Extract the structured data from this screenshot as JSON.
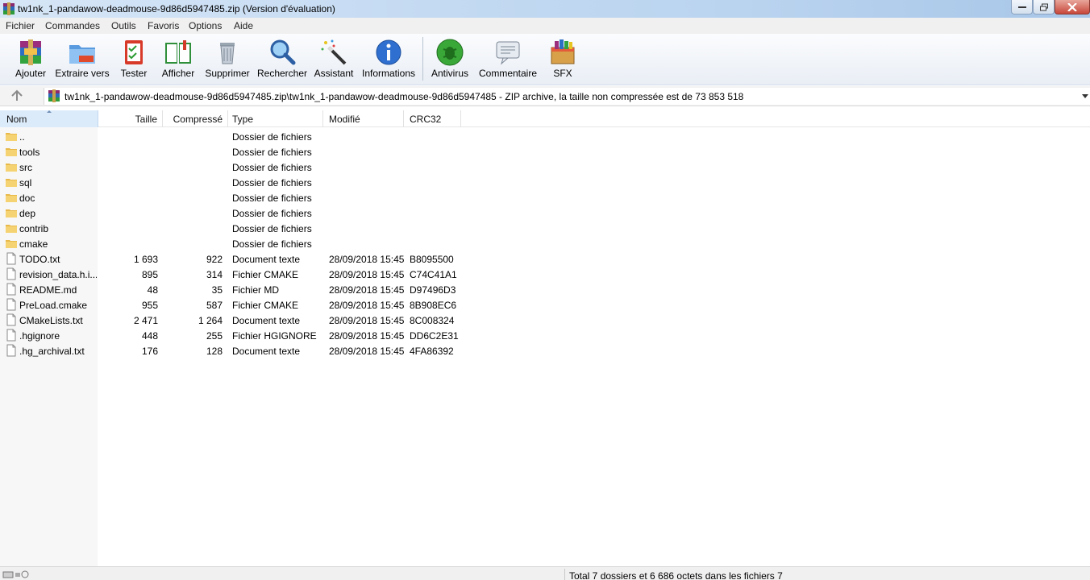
{
  "window": {
    "title": "tw1nk_1-pandawow-deadmouse-9d86d5947485.zip (Version d'évaluation)"
  },
  "menu": [
    "Fichier",
    "Commandes",
    "Outils",
    "Favoris",
    "Options",
    "Aide"
  ],
  "toolbar": {
    "buttons": [
      {
        "label": "Ajouter",
        "icon": "add-archive-icon"
      },
      {
        "label": "Extraire vers",
        "icon": "extract-folder-icon"
      },
      {
        "label": "Tester",
        "icon": "test-checklist-icon"
      },
      {
        "label": "Afficher",
        "icon": "view-book-icon"
      },
      {
        "label": "Supprimer",
        "icon": "trash-icon"
      },
      {
        "label": "Rechercher",
        "icon": "magnifier-icon"
      },
      {
        "label": "Assistant",
        "icon": "wizard-wand-icon"
      },
      {
        "label": "Informations",
        "icon": "info-icon"
      },
      {
        "label": "Antivirus",
        "icon": "antivirus-bug-icon"
      },
      {
        "label": "Commentaire",
        "icon": "comment-icon"
      },
      {
        "label": "SFX",
        "icon": "sfx-box-icon"
      }
    ]
  },
  "address": {
    "path": "tw1nk_1-pandawow-deadmouse-9d86d5947485.zip\\tw1nk_1-pandawow-deadmouse-9d86d5947485 - ZIP archive, la taille non compressée est de 73 853 518"
  },
  "columns": {
    "name": "Nom",
    "size": "Taille",
    "compressed": "Compressé",
    "type": "Type",
    "modified": "Modifié",
    "crc": "CRC32"
  },
  "files": [
    {
      "name": "..",
      "kind": "folder",
      "size": "",
      "compressed": "",
      "type": "Dossier de fichiers",
      "modified": "",
      "crc": ""
    },
    {
      "name": "tools",
      "kind": "folder",
      "size": "",
      "compressed": "",
      "type": "Dossier de fichiers",
      "modified": "",
      "crc": ""
    },
    {
      "name": "src",
      "kind": "folder",
      "size": "",
      "compressed": "",
      "type": "Dossier de fichiers",
      "modified": "",
      "crc": ""
    },
    {
      "name": "sql",
      "kind": "folder",
      "size": "",
      "compressed": "",
      "type": "Dossier de fichiers",
      "modified": "",
      "crc": ""
    },
    {
      "name": "doc",
      "kind": "folder",
      "size": "",
      "compressed": "",
      "type": "Dossier de fichiers",
      "modified": "",
      "crc": ""
    },
    {
      "name": "dep",
      "kind": "folder",
      "size": "",
      "compressed": "",
      "type": "Dossier de fichiers",
      "modified": "",
      "crc": ""
    },
    {
      "name": "contrib",
      "kind": "folder",
      "size": "",
      "compressed": "",
      "type": "Dossier de fichiers",
      "modified": "",
      "crc": ""
    },
    {
      "name": "cmake",
      "kind": "folder",
      "size": "",
      "compressed": "",
      "type": "Dossier de fichiers",
      "modified": "",
      "crc": ""
    },
    {
      "name": "TODO.txt",
      "kind": "file",
      "size": "1 693",
      "compressed": "922",
      "type": "Document texte",
      "modified": "28/09/2018 15:45",
      "crc": "B8095500"
    },
    {
      "name": "revision_data.h.i...",
      "kind": "file",
      "size": "895",
      "compressed": "314",
      "type": "Fichier CMAKE",
      "modified": "28/09/2018 15:45",
      "crc": "C74C41A1"
    },
    {
      "name": "README.md",
      "kind": "file",
      "size": "48",
      "compressed": "35",
      "type": "Fichier MD",
      "modified": "28/09/2018 15:45",
      "crc": "D97496D3"
    },
    {
      "name": "PreLoad.cmake",
      "kind": "file",
      "size": "955",
      "compressed": "587",
      "type": "Fichier CMAKE",
      "modified": "28/09/2018 15:45",
      "crc": "8B908EC6"
    },
    {
      "name": "CMakeLists.txt",
      "kind": "file",
      "size": "2 471",
      "compressed": "1 264",
      "type": "Document texte",
      "modified": "28/09/2018 15:45",
      "crc": "8C008324"
    },
    {
      "name": ".hgignore",
      "kind": "file",
      "size": "448",
      "compressed": "255",
      "type": "Fichier HGIGNORE",
      "modified": "28/09/2018 15:45",
      "crc": "DD6C2E31"
    },
    {
      "name": ".hg_archival.txt",
      "kind": "file",
      "size": "176",
      "compressed": "128",
      "type": "Document texte",
      "modified": "28/09/2018 15:45",
      "crc": "4FA86392"
    }
  ],
  "status": {
    "text": "Total 7 dossiers et 6 686 octets dans les fichiers 7"
  }
}
